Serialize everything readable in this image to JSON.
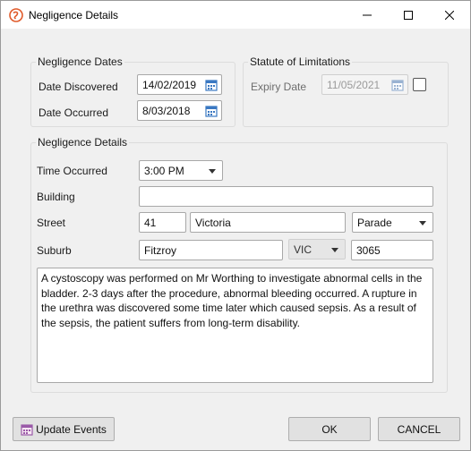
{
  "window": {
    "title": "Negligence Details",
    "controls": {
      "minimize_icon": "minimize-icon",
      "maximize_icon": "maximize-icon",
      "close_icon": "close-icon"
    }
  },
  "negligence_dates": {
    "title": "Negligence Dates",
    "date_discovered_label": "Date Discovered",
    "date_discovered_value": "14/02/2019",
    "date_occurred_label": "Date Occurred",
    "date_occurred_value": "8/03/2018"
  },
  "statute": {
    "title": "Statute of Limitations",
    "expiry_label": "Expiry Date",
    "expiry_value": "11/05/2021",
    "expiry_enabled": false
  },
  "details": {
    "title": "Negligence Details",
    "time_label": "Time Occurred",
    "time_value": "3:00 PM",
    "building_label": "Building",
    "building_value": "",
    "street_label": "Street",
    "street_number": "41",
    "street_name": "Victoria",
    "street_type": "Parade",
    "suburb_label": "Suburb",
    "suburb_value": "Fitzroy",
    "state_value": "VIC",
    "postcode_value": "3065",
    "description": "A cystoscopy was performed on Mr Worthing to investigate abnormal cells in the bladder. 2-3 days after the procedure, abnormal bleeding occurred. A rupture in the urethra was discovered some time later which caused sepsis. As a result of the sepsis, the patient suffers from long-term disability."
  },
  "buttons": {
    "update_events": "Update Events",
    "ok": "OK",
    "cancel": "CANCEL"
  },
  "colors": {
    "accent_calendar": "#3a78c2",
    "app_icon": "#e05a2a"
  }
}
